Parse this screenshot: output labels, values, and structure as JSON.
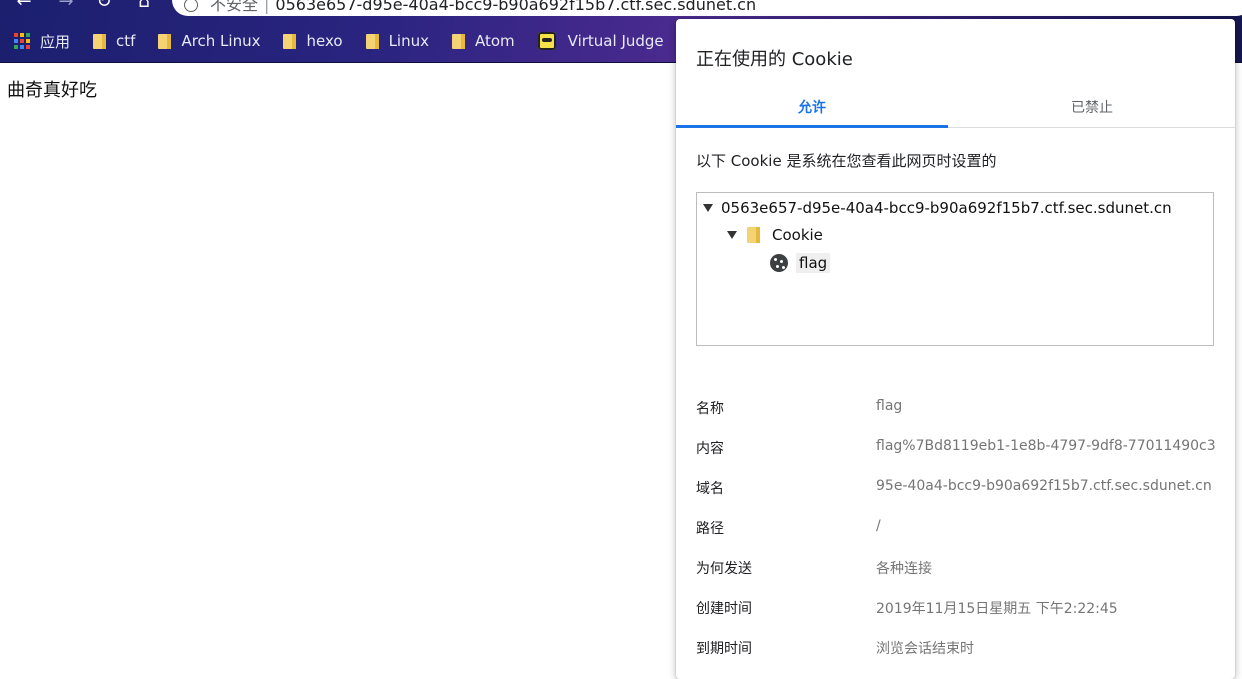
{
  "browser": {
    "url_security": "不安全",
    "url_host": "0563e657-d95e-40a4-bcc9-b90a692f15b7.ctf.sec.sdunet.cn",
    "bookmarks": {
      "apps_label": "应用",
      "items": [
        "ctf",
        "Arch Linux",
        "hexo",
        "Linux",
        "Atom"
      ],
      "virtual_judge": "Virtual Judge"
    },
    "accent_colors": [
      "#ea4335",
      "#fbbc05",
      "#34a853",
      "#4285f4"
    ]
  },
  "page": {
    "text": "曲奇真好吃"
  },
  "dialog": {
    "title": "正在使用的 Cookie",
    "tabs": {
      "allowed": "允许",
      "blocked": "已禁止"
    },
    "description": "以下 Cookie 是系统在您查看此网页时设置的",
    "tree": {
      "domain": "0563e657-d95e-40a4-bcc9-b90a692f15b7.ctf.sec.sdunet.cn",
      "folder": "Cookie",
      "cookie": "flag"
    },
    "details": [
      {
        "key": "名称",
        "value": "flag"
      },
      {
        "key": "内容",
        "value": "flag%7Bd8119eb1-1e8b-4797-9df8-77011490c3"
      },
      {
        "key": "域名",
        "value": "95e-40a4-bcc9-b90a692f15b7.ctf.sec.sdunet.cn"
      },
      {
        "key": "路径",
        "value": "/"
      },
      {
        "key": "为何发送",
        "value": "各种连接"
      },
      {
        "key": "创建时间",
        "value": "2019年11月15日星期五 下午2:22:45"
      },
      {
        "key": "到期时间",
        "value": "浏览会话结束时"
      }
    ],
    "accent": "#1a73e8"
  }
}
